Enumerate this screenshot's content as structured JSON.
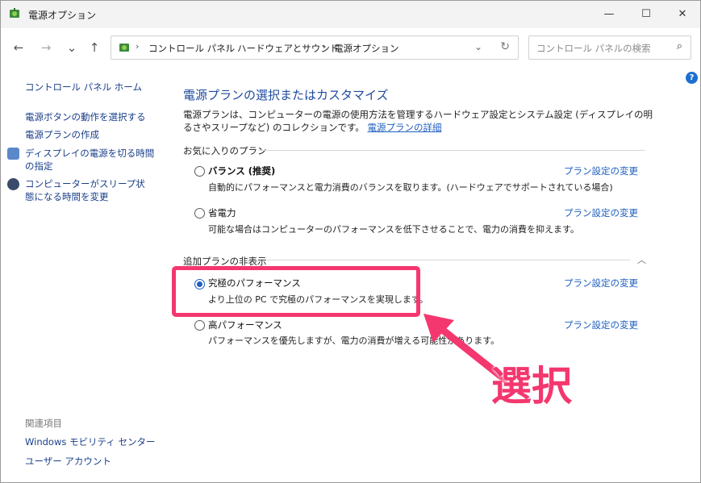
{
  "window": {
    "title": "電源オプション",
    "controls": {
      "minimize": "—",
      "maximize": "☐",
      "close": "✕"
    }
  },
  "nav": {
    "back": "←",
    "forward": "→",
    "recent": "⌄",
    "up": "↑"
  },
  "address": {
    "crumbs": [
      "コントロール パネル",
      "ハードウェアとサウンド",
      "電源オプション"
    ],
    "separator": "›",
    "dropdown": "⌄",
    "refresh": "↻"
  },
  "search": {
    "placeholder": "コントロール パネルの検索",
    "icon": "⌕"
  },
  "help": {
    "icon": "?"
  },
  "sidebar": {
    "home": "コントロール パネル ホーム",
    "links": [
      "電源ボタンの動作を選択する",
      "電源プランの作成",
      "ディスプレイの電源を切る時間の指定",
      "コンピューターがスリープ状態になる時間を変更"
    ],
    "related_header": "関連項目",
    "related": [
      "Windows モビリティ センター",
      "ユーザー アカウント"
    ]
  },
  "main": {
    "title": "電源プランの選択またはカスタマイズ",
    "description": "電源プランは、コンピューターの電源の使用方法を管理するハードウェア設定とシステム設定 (ディスプレイの明るさやスリープなど) のコレクションです。",
    "details_link": "電源プランの詳細",
    "favorites_header": "お気に入りのプラン",
    "hidden_header": "追加プランの非表示",
    "change_label": "プラン設定の変更",
    "plans": [
      {
        "name": "バランス (推奨)",
        "desc": "自動的にパフォーマンスと電力消費のバランスを取ります。(ハードウェアでサポートされている場合)",
        "selected": false
      },
      {
        "name": "省電力",
        "desc": "可能な場合はコンピューターのパフォーマンスを低下させることで、電力の消費を抑えます。",
        "selected": false
      },
      {
        "name": "究極のパフォーマンス",
        "desc": "より上位の PC で究極のパフォーマンスを実現します。",
        "selected": true
      },
      {
        "name": "高パフォーマンス",
        "desc": "パフォーマンスを優先しますが、電力の消費が増える可能性があります。",
        "selected": false
      }
    ]
  },
  "annotation": {
    "label": "選択",
    "color": "#f4376e"
  }
}
